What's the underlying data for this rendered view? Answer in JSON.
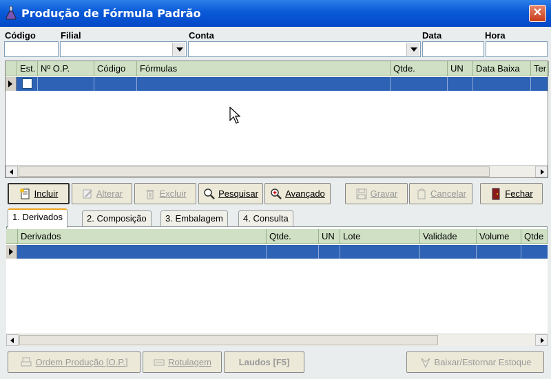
{
  "window": {
    "title": "Produção de Fórmula Padrão",
    "close_glyph": "✕"
  },
  "filters": {
    "codigo_label": "Código",
    "filial_label": "Filial",
    "conta_label": "Conta",
    "data_label": "Data",
    "hora_label": "Hora",
    "codigo_value": "",
    "filial_value": "",
    "conta_value": "",
    "data_value": "",
    "hora_value": ""
  },
  "main_grid": {
    "columns": [
      "Est.",
      "Nº O.P.",
      "Código",
      "Fórmulas",
      "Qtde.",
      "UN",
      "Data Baixa",
      "Ter"
    ],
    "selected_row": {
      "checked": false
    }
  },
  "toolbar": {
    "incluir": "Incluir",
    "alterar": "Alterar",
    "excluir": "Excluir",
    "pesquisar": "Pesquisar",
    "avancado": "Avançado",
    "gravar": "Gravar",
    "cancelar": "Cancelar",
    "fechar": "Fechar"
  },
  "tabs": {
    "derivados": "1. Derivados",
    "composicao": "2. Composição",
    "embalagem": "3. Embalagem",
    "consulta": "4. Consulta"
  },
  "derivados_grid": {
    "columns": [
      "Derivados",
      "Qtde.",
      "UN",
      "Lote",
      "Validade",
      "Volume",
      "Qtde"
    ]
  },
  "footer": {
    "ordem_producao": "Ordem Produção [O.P.]",
    "rotulagem": "Rotulagem",
    "laudos": "Laudos [F5]",
    "baixar_estornar": "Baixar/Estornar Estoque"
  },
  "icons": {
    "title": "flask-icon",
    "incluir": "new-document-icon",
    "alterar": "edit-icon",
    "excluir": "trash-icon",
    "pesquisar": "magnifier-icon",
    "avancado": "magnifier-plus-icon",
    "gravar": "save-icon",
    "cancelar": "undo-icon",
    "fechar": "exit-door-icon"
  }
}
